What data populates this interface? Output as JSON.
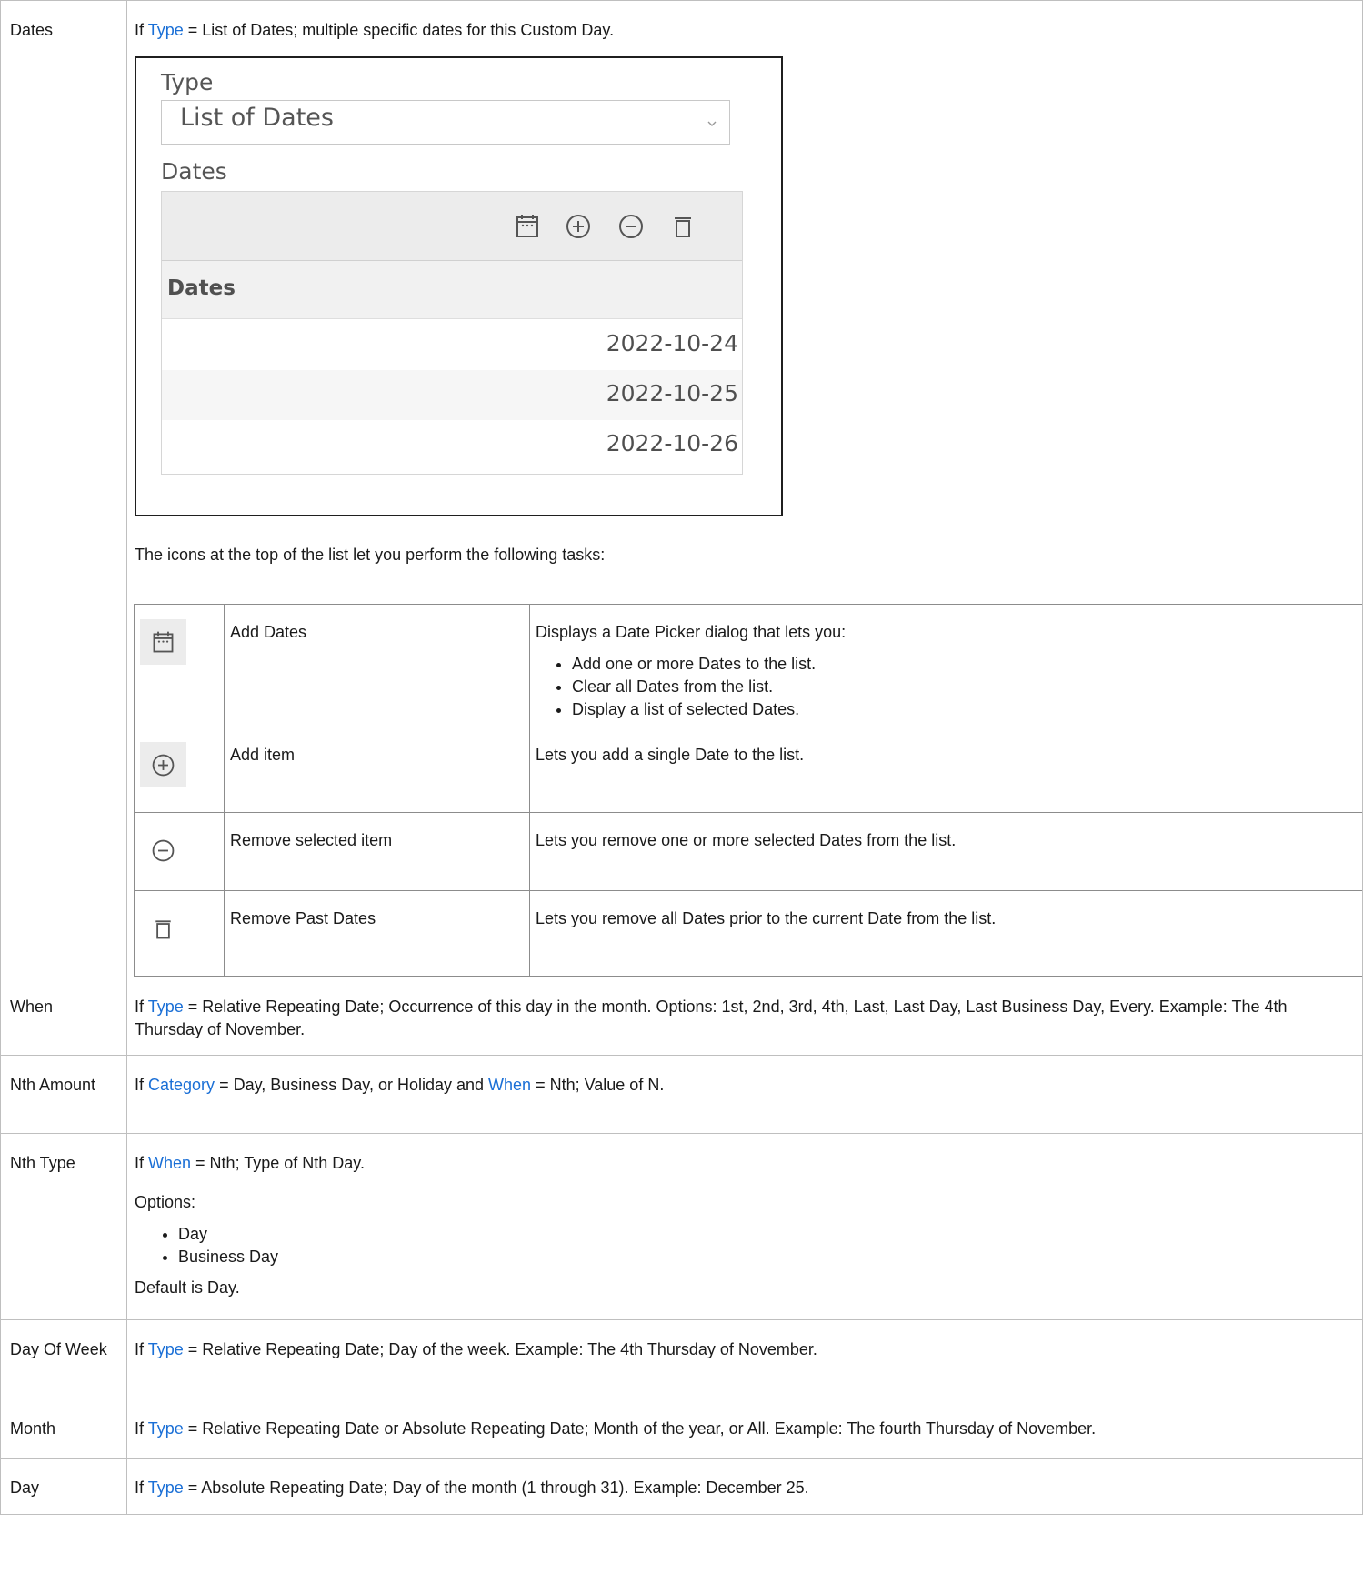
{
  "rows": {
    "dates": {
      "label": "Dates",
      "intro_prefix": "If ",
      "intro_link": "Type",
      "intro_suffix": " = List of Dates; multiple specific dates for this Custom Day.",
      "screenshot": {
        "type_label": "Type",
        "type_value": "List of Dates",
        "dates_label": "Dates",
        "column_header": "Dates",
        "date_rows": [
          "2022-10-24",
          "2022-10-25",
          "2022-10-26"
        ]
      },
      "icons_text": "The icons at the top of the list let you perform the following tasks:",
      "icon_table": [
        {
          "icon": "calendar-icon",
          "name": "Add Dates",
          "desc": "Displays a Date Picker dialog that lets you:",
          "bullets": [
            "Add one or more Dates to the list.",
            "Clear all Dates from the list.",
            "Display a list of selected Dates."
          ]
        },
        {
          "icon": "plus-circle-icon",
          "name": "Add item",
          "desc": "Lets you add a single Date to the list."
        },
        {
          "icon": "minus-circle-icon",
          "name": "Remove selected item",
          "desc": "Lets you remove one or more selected Dates from the list."
        },
        {
          "icon": "trash-icon",
          "name": "Remove Past Dates",
          "desc": "Lets you remove all Dates prior to the current Date from the list."
        }
      ]
    },
    "when": {
      "label": "When",
      "prefix": "If ",
      "link": "Type",
      "text": " = Relative Repeating Date; Occurrence of this day in the month. Options: 1st, 2nd, 3rd, 4th, Last, Last Day, Last Business Day, Every. Example: The 4th Thursday of November."
    },
    "nth_amount": {
      "label": "Nth Amount",
      "prefix": "If ",
      "link1": "Category",
      "middle": " = Day, Business Day, or Holiday and ",
      "link2": "When",
      "suffix": " = Nth; Value of N."
    },
    "nth_type": {
      "label": "Nth Type",
      "prefix": "If ",
      "link": "When",
      "suffix": " = Nth; Type of Nth Day.",
      "options_label": "Options:",
      "options": [
        "Day",
        "Business Day"
      ],
      "default_text": "Default is Day."
    },
    "day_of_week": {
      "label": "Day Of Week",
      "prefix": "If ",
      "link": "Type",
      "text": " = Relative Repeating Date; Day of the week. Example: The 4th Thursday of November."
    },
    "month": {
      "label": "Month",
      "prefix": "If ",
      "link": "Type",
      "text": " = Relative Repeating Date or Absolute Repeating Date; Month of the year, or All. Example: The fourth Thursday of November."
    },
    "day": {
      "label": "Day",
      "prefix": "If ",
      "link": "Type",
      "text": " = Absolute Repeating Date; Day of the month (1 through 31). Example: December 25."
    }
  },
  "colors": {
    "link": "#1a6fd6",
    "border": "#bfbfbf",
    "toolbar": "#ececec"
  }
}
